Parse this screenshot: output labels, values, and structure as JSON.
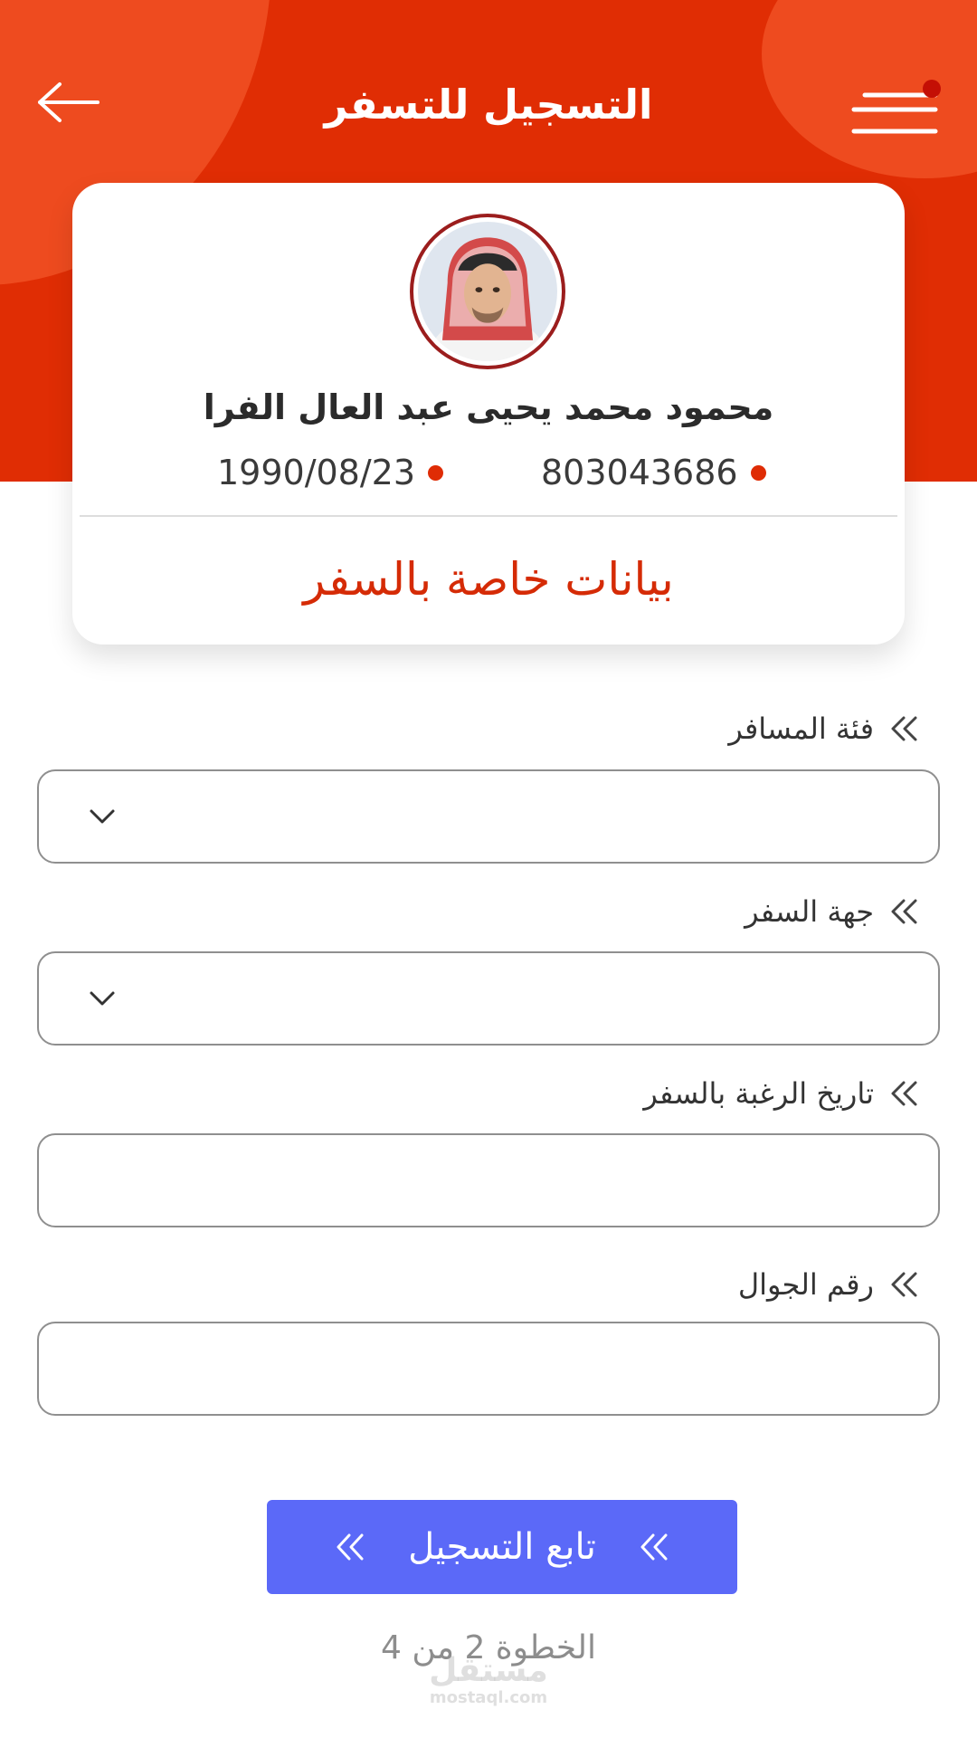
{
  "header": {
    "title": "التسجيل للتسفر",
    "back_icon": "arrow-left-icon",
    "menu_icon": "menu-icon",
    "has_notification": true,
    "accent_color": "#e02d04"
  },
  "profile": {
    "name": "محمود محمد يحيى عبد العال الفرا",
    "id_number": "803043686",
    "birth_date": "1990/08/23",
    "section_title": "بيانات خاصة بالسفر"
  },
  "form": {
    "fields": [
      {
        "label": "فئة المسافر",
        "type": "select",
        "value": "",
        "placeholder": ""
      },
      {
        "label": "جهة السفر",
        "type": "select",
        "value": "",
        "placeholder": ""
      },
      {
        "label": "تاريخ الرغبة بالسفر",
        "type": "text",
        "value": "",
        "placeholder": ""
      },
      {
        "label": "رقم الجوال",
        "type": "text",
        "value": "",
        "placeholder": ""
      }
    ]
  },
  "actions": {
    "continue_label": "تابع التسجيل",
    "continue_color": "#5b69f8"
  },
  "footer": {
    "step_text": "الخطوة 2 من 4"
  },
  "watermark": {
    "main": "مستقل",
    "sub": "mostaql.com"
  }
}
